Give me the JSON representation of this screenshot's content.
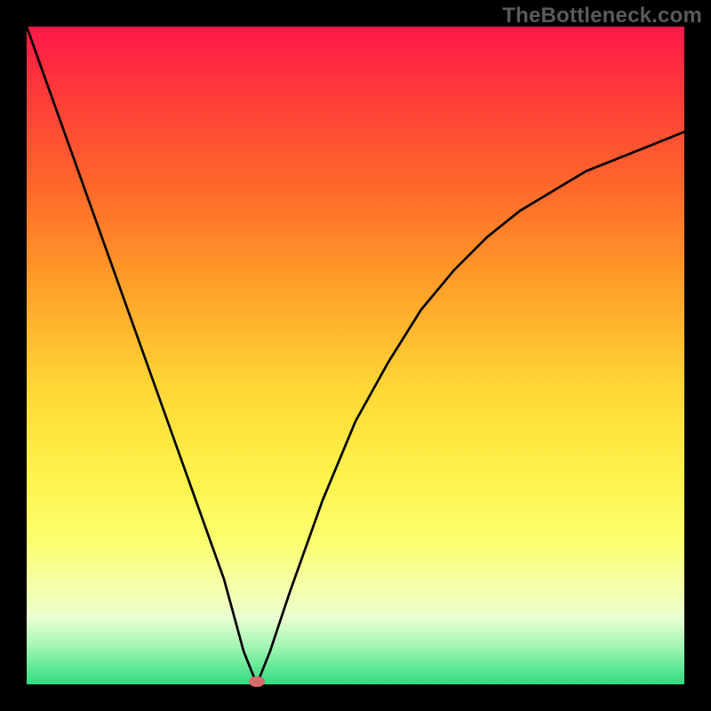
{
  "watermark": "TheBottleneck.com",
  "colors": {
    "frame_bg": "#000000",
    "gradient_top": "#ff1848",
    "gradient_bottom": "#2fdc82",
    "curve": "#000000",
    "marker": "#d86a6a"
  },
  "chart_data": {
    "type": "line",
    "title": "",
    "xlabel": "",
    "ylabel": "",
    "xlim": [
      0,
      100
    ],
    "ylim": [
      0,
      100
    ],
    "grid": false,
    "legend": false,
    "annotations": [
      "TheBottleneck.com"
    ],
    "minimum": {
      "x": 35,
      "y": 0
    },
    "series": [
      {
        "name": "bottleneck-curve",
        "x": [
          0,
          5,
          10,
          15,
          20,
          25,
          30,
          33,
          35,
          37,
          40,
          45,
          50,
          55,
          60,
          65,
          70,
          75,
          80,
          85,
          90,
          95,
          100
        ],
        "y": [
          100,
          86,
          72,
          58,
          44,
          30,
          16,
          5,
          0,
          5,
          14,
          28,
          40,
          49,
          57,
          63,
          68,
          72,
          75,
          78,
          80,
          82,
          84
        ]
      }
    ],
    "marker_points": [
      {
        "x": 35,
        "y": 0
      }
    ]
  }
}
